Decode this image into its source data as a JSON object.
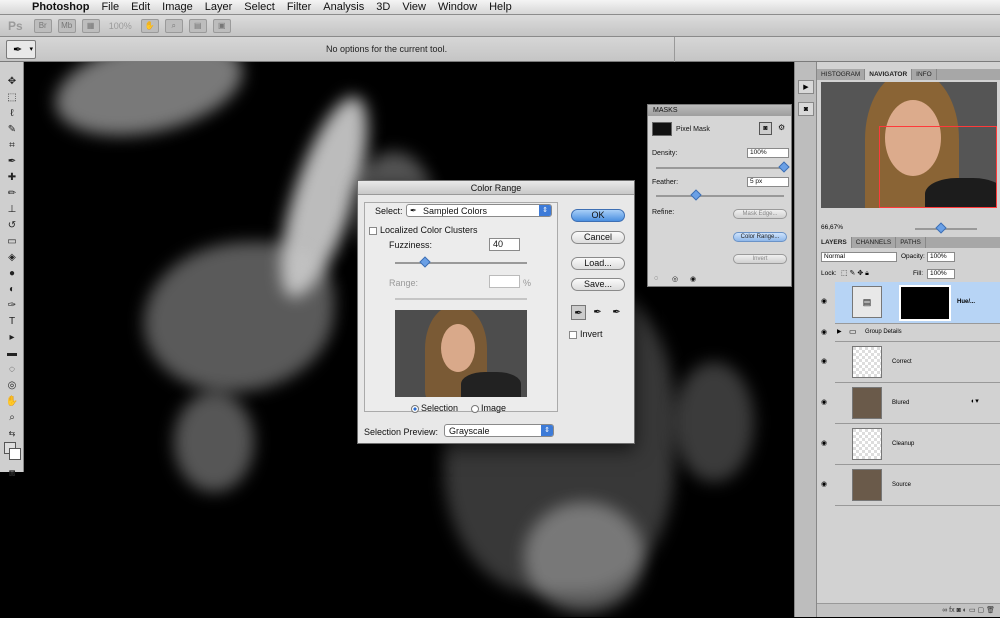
{
  "menubar": {
    "app": "Photoshop",
    "items": [
      "File",
      "Edit",
      "Image",
      "Layer",
      "Select",
      "Filter",
      "Analysis",
      "3D",
      "View",
      "Window",
      "Help"
    ]
  },
  "appbar": {
    "logo": "Ps",
    "zoom": "100%",
    "br": "Br",
    "mb": "Mb"
  },
  "options": {
    "message": "No options for the current tool."
  },
  "dialog": {
    "title": "Color Range",
    "select_label": "Select:",
    "select_value": "Sampled Colors",
    "localized_label": "Localized Color Clusters",
    "fuzziness_label": "Fuzziness:",
    "fuzziness_value": "40",
    "fuzziness_fraction": 0.2,
    "range_label": "Range:",
    "range_unit": "%",
    "selection_label": "Selection",
    "image_label": "Image",
    "preview_label": "Selection Preview:",
    "preview_value": "Grayscale",
    "ok": "OK",
    "cancel": "Cancel",
    "load": "Load...",
    "save": "Save...",
    "invert": "Invert"
  },
  "masks": {
    "title": "MASKS",
    "pixel_mask": "Pixel Mask",
    "density_label": "Density:",
    "density_value": "100%",
    "feather_label": "Feather:",
    "feather_value": "5 px",
    "refine_label": "Refine:",
    "mask_edge": "Mask Edge...",
    "color_range": "Color Range...",
    "invert": "Invert"
  },
  "navigator": {
    "tabs": [
      "HISTOGRAM",
      "NAVIGATOR",
      "INFO"
    ],
    "zoom": "66,67%"
  },
  "layers": {
    "tabs": [
      "LAYERS",
      "CHANNELS",
      "PATHS"
    ],
    "blend": "Normal",
    "opacity_label": "Opacity:",
    "opacity": "100%",
    "lock_label": "Lock:",
    "fill_label": "Fill:",
    "fill": "100%",
    "items": [
      "Hue/...",
      "Group Details",
      "Correct",
      "Blured",
      "Cleanup",
      "Source"
    ]
  }
}
